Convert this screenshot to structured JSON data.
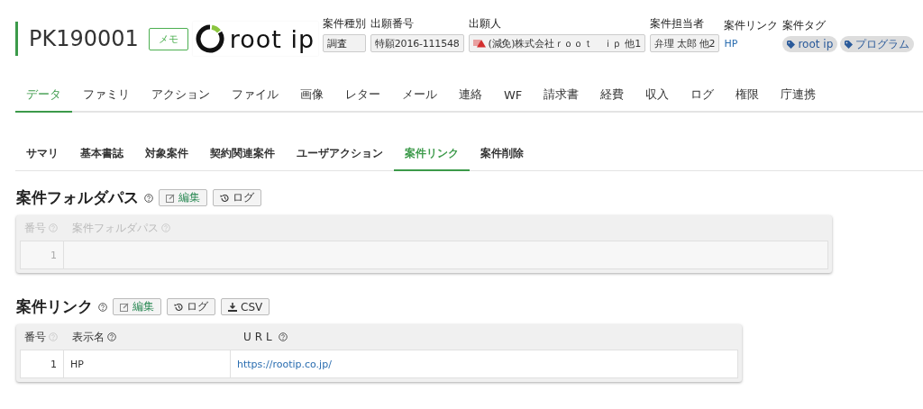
{
  "case": {
    "id": "PK190001",
    "memo_button": "メモ",
    "logo": "root ip"
  },
  "fields": [
    {
      "label": "案件種別",
      "kind": "box",
      "value": "調査"
    },
    {
      "label": "出願番号",
      "kind": "box",
      "value": "特願2016-111548"
    },
    {
      "label": "出願人",
      "kind": "applicant",
      "value": "(減免)株式会社ｒｏｏｔ　ｉｐ 他1"
    },
    {
      "label": "案件担当者",
      "kind": "box",
      "value": "弁理 太郎 他2"
    },
    {
      "label": "案件リンク",
      "kind": "link",
      "value": "HP"
    },
    {
      "label": "案件タグ",
      "kind": "tags",
      "tags": [
        "root ip",
        "プログラム"
      ]
    }
  ],
  "tabs": [
    {
      "label": "データ",
      "selected": true
    },
    {
      "label": "ファミリ",
      "selected": false
    },
    {
      "label": "アクション",
      "selected": false
    },
    {
      "label": "ファイル",
      "selected": false
    },
    {
      "label": "画像",
      "selected": false
    },
    {
      "label": "レター",
      "selected": false
    },
    {
      "label": "メール",
      "selected": false
    },
    {
      "label": "連絡",
      "selected": false
    },
    {
      "label": "WF",
      "selected": false
    },
    {
      "label": "請求書",
      "selected": false
    },
    {
      "label": "経費",
      "selected": false
    },
    {
      "label": "収入",
      "selected": false
    },
    {
      "label": "ログ",
      "selected": false
    },
    {
      "label": "権限",
      "selected": false
    },
    {
      "label": "庁連携",
      "selected": false
    }
  ],
  "subtabs": [
    {
      "label": "サマリ",
      "selected": false
    },
    {
      "label": "基本書誌",
      "selected": false
    },
    {
      "label": "対象案件",
      "selected": false
    },
    {
      "label": "契約関連案件",
      "selected": false
    },
    {
      "label": "ユーザアクション",
      "selected": false
    },
    {
      "label": "案件リンク",
      "selected": true
    },
    {
      "label": "案件削除",
      "selected": false
    }
  ],
  "sections": [
    {
      "title": "案件フォルダパス",
      "disabled": true,
      "buttons": [
        {
          "kind": "edit",
          "label": "編集"
        },
        {
          "kind": "log",
          "label": "ログ"
        }
      ],
      "columns": [
        {
          "label": "番号",
          "kind": "number"
        },
        {
          "label": "案件フォルダパス",
          "kind": "text"
        }
      ],
      "rows": [
        [
          "1"
        ]
      ]
    },
    {
      "title": "案件リンク",
      "disabled": false,
      "buttons": [
        {
          "kind": "edit",
          "label": "編集"
        },
        {
          "kind": "log",
          "label": "ログ"
        },
        {
          "kind": "csv",
          "label": "CSV"
        }
      ],
      "columns": [
        {
          "label": "番号",
          "kind": "number"
        },
        {
          "label": "表示名",
          "kind": "text"
        },
        {
          "label": "URL",
          "kind": "link"
        }
      ],
      "rows": [
        [
          "1",
          "HP",
          "https://rootip.co.jp/"
        ]
      ]
    }
  ]
}
